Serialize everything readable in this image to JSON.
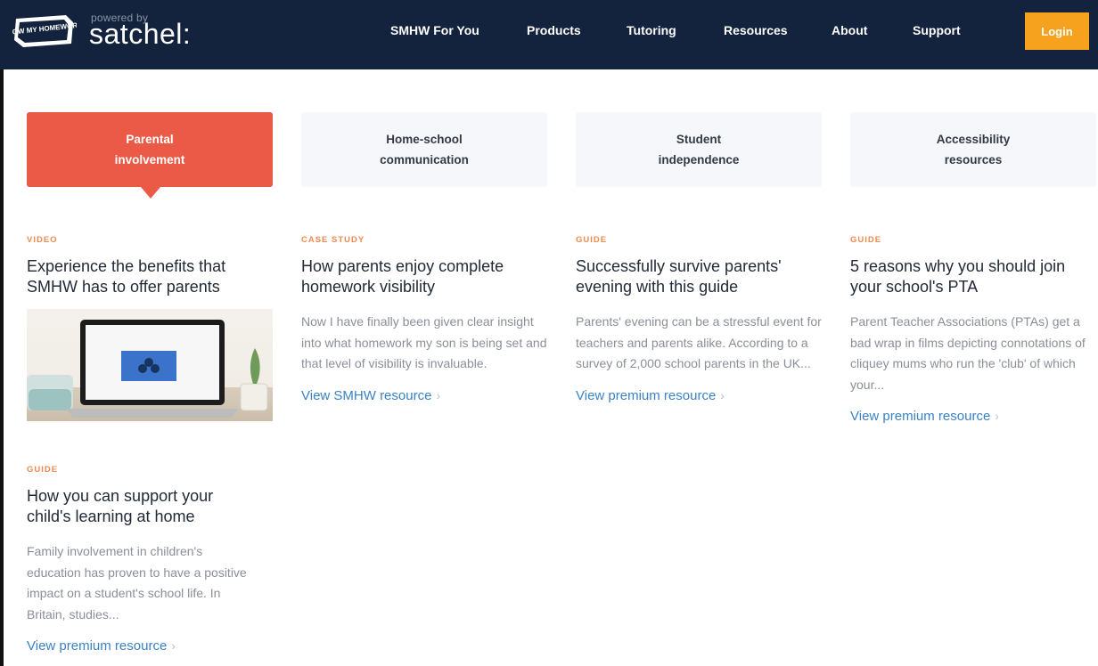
{
  "header": {
    "powered_by": "powered by",
    "brand": "satchel:",
    "badge_text": "SHOW MY HOMEWORK",
    "nav": [
      {
        "label": "SMHW For You"
      },
      {
        "label": "Products"
      },
      {
        "label": "Tutoring"
      },
      {
        "label": "Resources"
      },
      {
        "label": "About"
      },
      {
        "label": "Support"
      }
    ],
    "login_label": "Login"
  },
  "tabs": [
    {
      "label": "Parental involvement",
      "active": true
    },
    {
      "label": "Home-school communication",
      "active": false
    },
    {
      "label": "Student independence",
      "active": false
    },
    {
      "label": "Accessibility resources",
      "active": false
    }
  ],
  "cards": [
    {
      "kicker": "VIDEO",
      "title": "Experience the benefits that SMHW has to offer parents",
      "media": "video-thumbnail"
    },
    {
      "kicker": "CASE STUDY",
      "title": "How parents enjoy complete homework visibility",
      "description": "Now I have finally been given clear insight into what homework my son is being set and that level of visibility is invaluable.",
      "link": "View SMHW resource"
    },
    {
      "kicker": "GUIDE",
      "title": "Successfully survive parents' evening with this guide",
      "description": "Parents' evening can be a stressful event for teachers and parents alike. According to a survey of 2,000 school parents in the UK...",
      "link": "View premium resource"
    },
    {
      "kicker": "GUIDE",
      "title": "5 reasons why you should join your school's PTA",
      "description": "Parent Teacher Associations (PTAs) get a bad wrap in films depicting connotations of cliquey mums who run the 'club' of which your...",
      "link": "View premium resource"
    },
    {
      "kicker": "GUIDE",
      "title": "How you can support your child's learning at home",
      "description": "Family involvement in children's education has proven to have a positive impact on a student's school life. In Britain, studies...",
      "link": "View premium resource"
    }
  ],
  "colors": {
    "header_bg": "#13233d",
    "accent_active_tab": "#ea5a47",
    "login_bg": "#f6a21e",
    "kicker": "#ee8a4f",
    "link": "#3b82c4"
  },
  "icons": {
    "link_chevron": "chevron-right-icon",
    "video_play": "play-icon"
  }
}
